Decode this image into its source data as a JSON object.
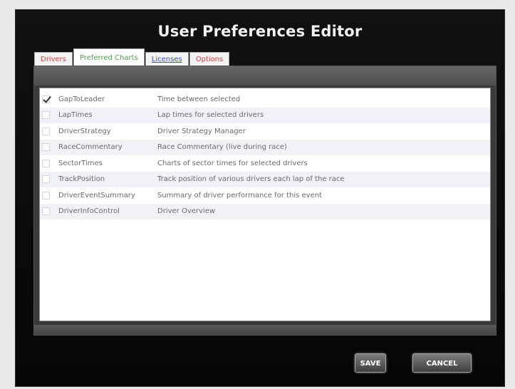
{
  "window": {
    "title": "User Preferences Editor"
  },
  "tabs": [
    {
      "label": "Drivers",
      "color": "#d94040",
      "active": false
    },
    {
      "label": "Preferred Charts",
      "color": "#52a052",
      "active": true
    },
    {
      "label": "Licenses",
      "color": "#3a4fd0",
      "active": false
    },
    {
      "label": "Options",
      "color": "#d94040",
      "active": false
    }
  ],
  "charts": [
    {
      "name": "GapToLeader",
      "description": "Time between selected",
      "checked": true
    },
    {
      "name": "LapTimes",
      "description": "Lap times for selected drivers",
      "checked": false
    },
    {
      "name": "DriverStrategy",
      "description": "Driver Strategy Manager",
      "checked": false
    },
    {
      "name": "RaceCommentary",
      "description": "Race Commentary (live during race)",
      "checked": false
    },
    {
      "name": "SectorTimes",
      "description": "Charts of sector times for selected drivers",
      "checked": false
    },
    {
      "name": "TrackPosition",
      "description": "Track position of various drivers each lap of the race",
      "checked": false
    },
    {
      "name": "DriverEventSummary",
      "description": "Summary of driver performance for this event",
      "checked": false
    },
    {
      "name": "DriverInfoControl",
      "description": "Driver Overview",
      "checked": false
    }
  ],
  "buttons": {
    "save_label": "SAVE",
    "cancel_label": "CANCEL"
  }
}
